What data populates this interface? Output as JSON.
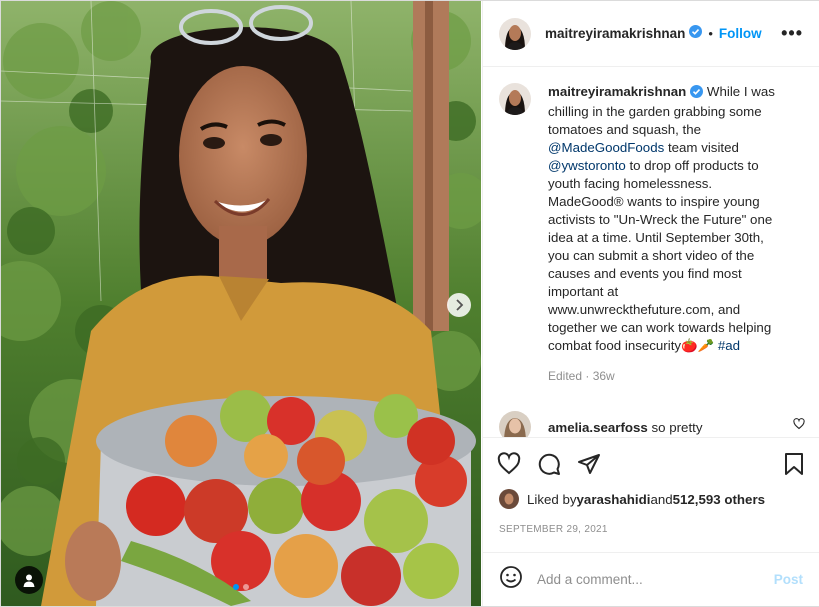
{
  "post": {
    "username": "maitreyiramakrishnan",
    "follow_label": "Follow",
    "dot_separator": "•",
    "more_label": "•••"
  },
  "caption": {
    "username": "maitreyiramakrishnan",
    "text_1": "While I was chilling in the garden grabbing some tomatoes and squash, the ",
    "mention_1": "@MadeGoodFoods",
    "text_2": " team visited ",
    "mention_2": "@ywstoronto",
    "text_3": " to drop off products to youth facing homelessness. MadeGood® wants to inspire young activists to \"Un-Wreck the Future\" one idea at a time. Until September 30th, you can submit a short video of the causes and events you find most important at www.unwreckthefuture.com, and together we can work towards helping combat food insecurity🍅🥕 ",
    "hashtag": "#ad",
    "edited": "Edited",
    "separator": " · ",
    "age": "36w"
  },
  "comment": {
    "username": "amelia.searfoss",
    "text": "so pretty"
  },
  "likes": {
    "prefix": "Liked by ",
    "user": "yarashahidi",
    "middle": " and ",
    "count": "512,593 others"
  },
  "date": "SEPTEMBER 29, 2021",
  "add_comment": {
    "placeholder": "Add a comment...",
    "post_label": "Post"
  },
  "carousel": {
    "total": 2,
    "active": 1
  },
  "colors": {
    "accent": "#0095f6",
    "link": "#00376b",
    "muted": "#8e8e8e"
  }
}
